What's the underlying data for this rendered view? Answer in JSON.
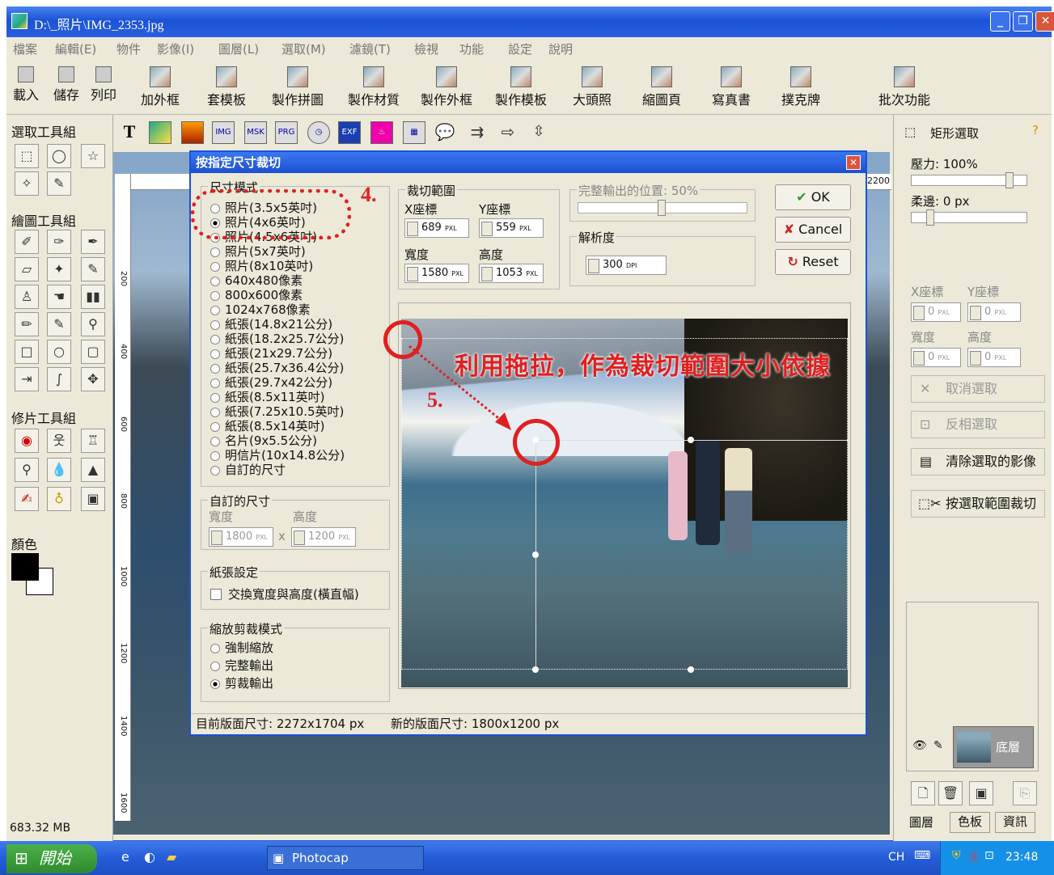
{
  "window": {
    "title": "D:\\_照片\\IMG_2353.jpg"
  },
  "menu": [
    "檔案",
    "編輯(E)",
    "物件",
    "影像(I)",
    "圖層(L)",
    "選取(M)",
    "濾鏡(T)",
    "檢視",
    "功能",
    "設定",
    "說明"
  ],
  "toolbar": [
    {
      "label": "載入",
      "icon": "open-icon"
    },
    {
      "label": "儲存",
      "icon": "save-icon"
    },
    {
      "label": "列印",
      "icon": "print-icon"
    },
    {
      "label": "加外框",
      "icon": "frame-icon"
    },
    {
      "label": "套模板",
      "icon": "template-icon"
    },
    {
      "label": "製作拼圖",
      "icon": "puzzle-icon"
    },
    {
      "label": "製作材質",
      "icon": "texture-icon"
    },
    {
      "label": "製作外框",
      "icon": "make-frame-icon"
    },
    {
      "label": "製作模板",
      "icon": "make-template-icon"
    },
    {
      "label": "大頭照",
      "icon": "id-photo-icon"
    },
    {
      "label": "縮圖頁",
      "icon": "thumbnail-icon"
    },
    {
      "label": "寫真書",
      "icon": "photobook-icon"
    },
    {
      "label": "撲克牌",
      "icon": "cards-icon"
    },
    {
      "label": "批次功能",
      "icon": "batch-icon"
    }
  ],
  "left": {
    "select_group": "選取工具組",
    "draw_group": "繪圖工具組",
    "retouch_group": "修片工具組",
    "color_label": "顏色",
    "memory": "683.32 MB"
  },
  "toolrow2": [
    "T",
    "IMG",
    "MSK",
    "PRG",
    "EXF"
  ],
  "right": {
    "tool_title": "矩形選取",
    "pressure": "壓力: 100%",
    "feather": "柔邊: 0 px",
    "x_label": "X座標",
    "y_label": "Y座標",
    "w_label": "寬度",
    "h_label": "高度",
    "x": "0",
    "y": "0",
    "w": "0",
    "h": "0",
    "unit": "PXL",
    "cancel_sel": "取消選取",
    "invert_sel": "反相選取",
    "clear_sel": "清除選取的影像",
    "crop_sel": "按選取範圍裁切",
    "layer_name": "底層",
    "tabs": [
      "圖層",
      "色板",
      "資訊"
    ]
  },
  "ruler": {
    "top_right": "2200",
    "marks": [
      "200",
      "400",
      "600",
      "800",
      "1000",
      "1200",
      "1400",
      "1600"
    ]
  },
  "dialog": {
    "title": "按指定尺寸裁切",
    "size_mode": "尺寸模式",
    "sizes": [
      "照片(3.5x5英吋)",
      "照片(4x6英吋)",
      "照片(4.5x6英吋)",
      "照片(5x7英吋)",
      "照片(8x10英吋)",
      "640x480像素",
      "800x600像素",
      "1024x768像素",
      "紙張(14.8x21公分)",
      "紙張(18.2x25.7公分)",
      "紙張(21x29.7公分)",
      "紙張(25.7x36.4公分)",
      "紙張(29.7x42公分)",
      "紙張(8.5x11英吋)",
      "紙張(7.25x10.5英吋)",
      "紙張(8.5x14英吋)",
      "名片(9x5.5公分)",
      "明信片(10x14.8公分)",
      "自訂的尺寸"
    ],
    "selected_size": 1,
    "custom_size": "自訂的尺寸",
    "custom_w_label": "寬度",
    "custom_h_label": "高度",
    "custom_w": "1800",
    "custom_h": "1200",
    "times": "x",
    "paper_settings": "紙張設定",
    "swap_label": "交換寬度與高度(橫直幅)",
    "scale_mode": "縮放剪裁模式",
    "scale_opts": [
      "強制縮放",
      "完整輸出",
      "剪裁輸出"
    ],
    "selected_scale": 2,
    "crop_range": "裁切範圍",
    "x_label": "X座標",
    "y_label": "Y座標",
    "w_label": "寬度",
    "h_label": "高度",
    "x": "689",
    "y": "559",
    "w": "1580",
    "h": "1053",
    "unit": "PXL",
    "output_pos": "完整輸出的位置: 50%",
    "resolution": "解析度",
    "dpi": "300",
    "dpi_unit": "DPI",
    "ok": "OK",
    "cancel": "Cancel",
    "reset": "Reset",
    "current_size": "目前版面尺寸: 2272x1704 px",
    "new_size": "新的版面尺寸: 1800x1200 px"
  },
  "annotations": {
    "step4": "4.",
    "step5": "5.",
    "hint": "利用拖拉，作為裁切範圍大小依據"
  },
  "taskbar": {
    "start": "開始",
    "task": "Photocap",
    "lang": "CH",
    "time": "23:48"
  }
}
